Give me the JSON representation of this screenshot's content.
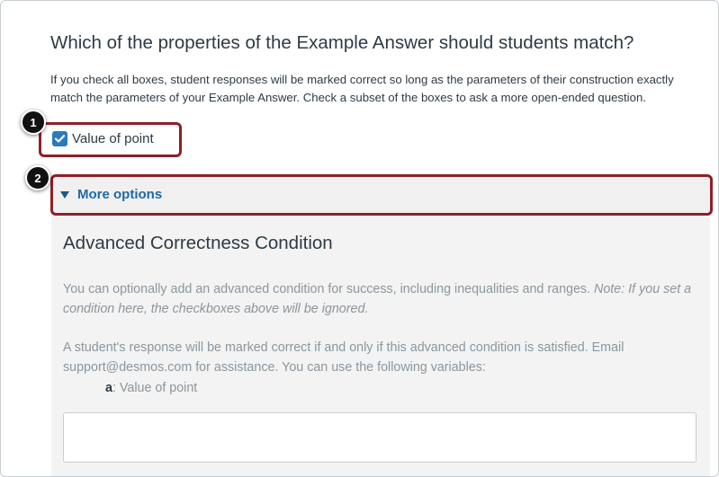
{
  "question": {
    "title": "Which of the properties of the Example Answer should students match?",
    "help_text": "If you check all boxes, student responses will be marked correct so long as the parameters of their construction exactly match the parameters of your Example Answer. Check a subset of the boxes to ask a more open-ended question."
  },
  "checkbox": {
    "label": "Value of point",
    "checked": true,
    "icon": "checkmark-icon"
  },
  "more_options": {
    "label": "More options",
    "icon": "triangle-down-icon",
    "expanded": true
  },
  "advanced": {
    "title": "Advanced Correctness Condition",
    "description_plain": "You can optionally add an advanced condition for success, including inequalities and ranges. ",
    "description_note": "Note: If you set a condition here, the checkboxes above will be ignored.",
    "instructions": "A student's response will be marked correct if and only if this advanced condition is satisfied. Email support@desmos.com for assistance. You can use the following variables:",
    "variables": [
      {
        "name": "a",
        "description": ": Value of point"
      }
    ],
    "condition_value": ""
  },
  "annotations": [
    {
      "number": "1"
    },
    {
      "number": "2"
    }
  ],
  "colors": {
    "accent": "#2b7abc",
    "link": "#1d6aa6",
    "annotation_border": "#8f1f28",
    "panel_background": "#f3f3f3"
  }
}
